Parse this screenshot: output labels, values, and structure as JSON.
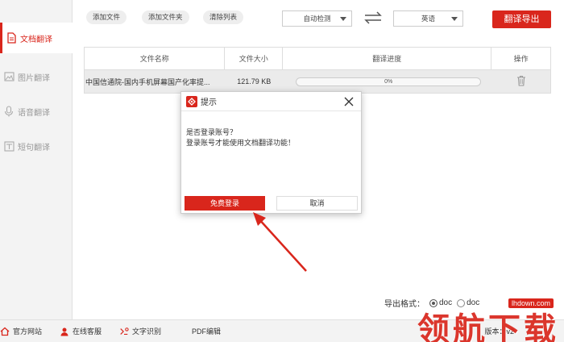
{
  "sidebar": {
    "items": [
      {
        "label": "文档翻译",
        "icon": "document-icon",
        "active": true
      },
      {
        "label": "图片翻译",
        "icon": "image-icon",
        "active": false
      },
      {
        "label": "语音翻译",
        "icon": "microphone-icon",
        "active": false
      },
      {
        "label": "短句翻译",
        "icon": "text-icon",
        "active": false
      }
    ]
  },
  "toolbar": {
    "add_file": "添加文件",
    "add_folder": "添加文件夹",
    "clear_list": "清除列表",
    "source_lang": "自动检测",
    "target_lang": "英语",
    "export_button": "翻译导出"
  },
  "table": {
    "headers": [
      "文件名称",
      "文件大小",
      "翻译进度",
      "操作"
    ],
    "rows": [
      {
        "name": "中国信通院-国内手机屏幕国产化率提...",
        "size": "121.79 KB",
        "progress_text": "0%",
        "progress": 0
      }
    ]
  },
  "dialog": {
    "title": "提示",
    "line1": "是否登录账号？",
    "line2": "登录账号才能使用文档翻译功能！",
    "login_button": "免费登录",
    "cancel_button": "取消"
  },
  "export_format": {
    "label": "导出格式：",
    "option1": "doc",
    "option2": "doc"
  },
  "bottombar": {
    "items": [
      {
        "label": "官方网站",
        "icon": "home-icon"
      },
      {
        "label": "在线客服",
        "icon": "support-icon"
      },
      {
        "label": "文字识别",
        "icon": "ocr-icon"
      },
      {
        "label": "PDF编辑",
        "icon": "pdf-icon"
      }
    ],
    "version": "版本：v2"
  },
  "watermark": {
    "badge": "lhdown.com",
    "text": "领航下载"
  },
  "colors": {
    "accent": "#d9261c",
    "sidebar_bg": "#f3f3f3",
    "row_bg": "#ebebeb"
  }
}
